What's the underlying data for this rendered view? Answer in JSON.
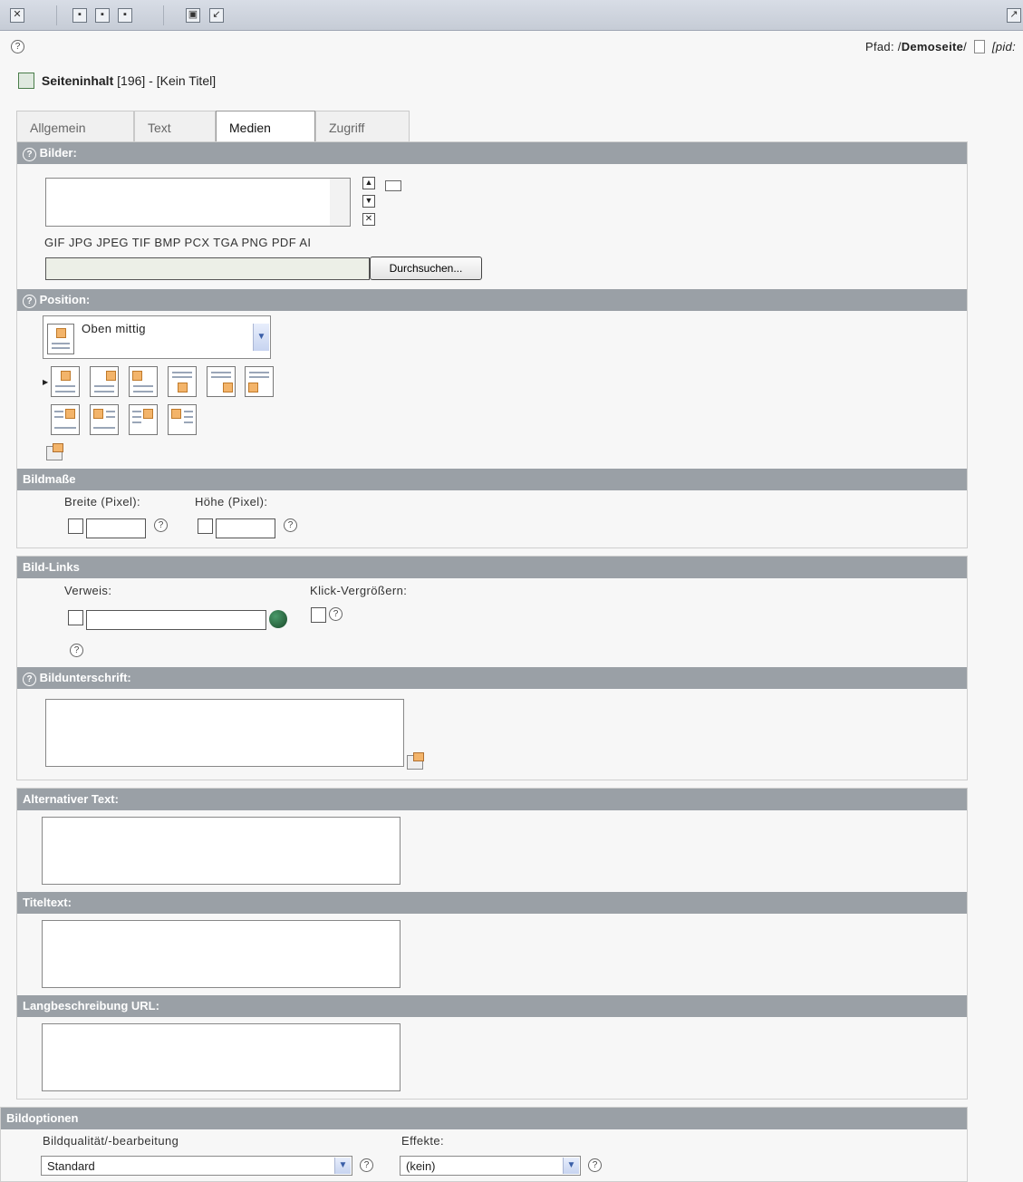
{
  "toolbar": {
    "icons": [
      "close-icon",
      "save-icon",
      "save-view-icon",
      "save-close-icon",
      "delete-icon",
      "undo-icon",
      "open-new-window-icon"
    ]
  },
  "path": {
    "prefix": "Pfad: /",
    "page": "Demoseite",
    "suffix": "/",
    "pid": "[pid:"
  },
  "record": {
    "label": "Seiteninhalt",
    "id": "[196]",
    "sep": " - ",
    "title": "[Kein Titel]"
  },
  "tabs": [
    "Allgemein",
    "Text",
    "Medien",
    "Zugriff"
  ],
  "active_tab": "Medien",
  "images": {
    "heading": "Bilder:",
    "filetypes": "GIF JPG JPEG TIF BMP PCX TGA PNG PDF AI",
    "browse_label": "Durchsuchen..."
  },
  "position": {
    "heading": "Position:",
    "selected": "Oben mittig"
  },
  "dimensions": {
    "heading": "Bildmaße",
    "width_label": "Breite (Pixel):",
    "height_label": "Höhe (Pixel):"
  },
  "links": {
    "heading": "Bild-Links",
    "link_label": "Verweis:",
    "zoom_label": "Klick-Vergrößern:"
  },
  "caption": {
    "heading": "Bildunterschrift:"
  },
  "alt_text": {
    "heading": "Alternativer Text:"
  },
  "title_text": {
    "heading": "Titeltext:"
  },
  "longdesc": {
    "heading": "Langbeschreibung URL:"
  },
  "options": {
    "heading": "Bildoptionen",
    "quality_label": "Bildqualität/-bearbeitung",
    "quality_value": "Standard",
    "effects_label": "Effekte:",
    "effects_value": "(kein)"
  },
  "colors": {
    "section_header": "#9aa0a6",
    "toolbar": "#c6ccd6",
    "accent": "#f3b46a"
  }
}
